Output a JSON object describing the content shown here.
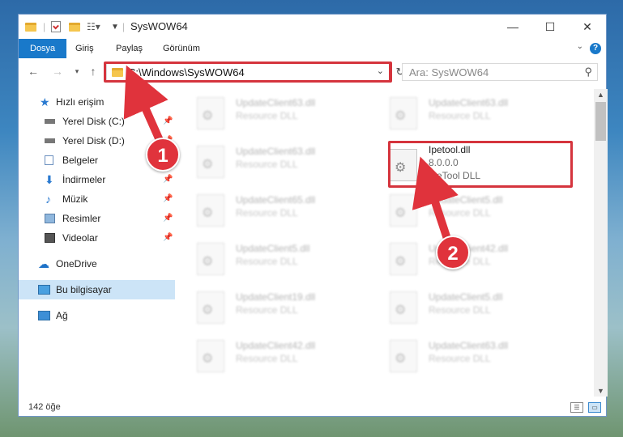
{
  "window": {
    "title": "SysWOW64",
    "controls": {
      "minimize": "—",
      "maximize": "☐",
      "close": "✕"
    }
  },
  "ribbon": {
    "tabs": [
      "Dosya",
      "Giriş",
      "Paylaş",
      "Görünüm"
    ],
    "help": "?"
  },
  "address_bar": {
    "path": "C:\\Windows\\SysWOW64"
  },
  "search": {
    "placeholder": "Ara: SysWOW64"
  },
  "sidebar": {
    "items": [
      {
        "label": "Hızlı erişim",
        "icon": "star-icon",
        "pinned": false
      },
      {
        "label": "Yerel Disk (C:)",
        "icon": "drive-icon",
        "pinned": true
      },
      {
        "label": "Yerel Disk (D:)",
        "icon": "drive-icon",
        "pinned": true
      },
      {
        "label": "Belgeler",
        "icon": "documents-icon",
        "pinned": true
      },
      {
        "label": "İndirmeler",
        "icon": "download-icon",
        "pinned": true
      },
      {
        "label": "Müzik",
        "icon": "music-icon",
        "pinned": true
      },
      {
        "label": "Resimler",
        "icon": "pictures-icon",
        "pinned": true
      },
      {
        "label": "Videolar",
        "icon": "video-icon",
        "pinned": true
      },
      {
        "label": "OneDrive",
        "icon": "cloud-icon",
        "pinned": false
      },
      {
        "label": "Bu bilgisayar",
        "icon": "computer-icon",
        "pinned": false,
        "selected": true
      },
      {
        "label": "Ağ",
        "icon": "network-icon",
        "pinned": false
      }
    ]
  },
  "files": {
    "left_column": [
      {
        "name": "UpdateClient63.dll",
        "type": "Resource DLL"
      },
      {
        "name": "UpdateClient63.dll",
        "type": "Resource DLL"
      },
      {
        "name": "UpdateClient65.dll",
        "type": "Resource DLL"
      },
      {
        "name": "UpdateClient5.dll",
        "type": "Resource DLL"
      },
      {
        "name": "UpdateClient19.dll",
        "type": "Resource DLL"
      },
      {
        "name": "UpdateClient42.dll",
        "type": "Resource DLL"
      }
    ],
    "right_column": [
      {
        "name": "UpdateClient63.dll",
        "type": "Resource DLL"
      },
      {
        "name": "UpdateClient5.dll",
        "type": "Resource DLL"
      },
      {
        "name": "UpdateClient42.dll",
        "type": "Resource DLL"
      },
      {
        "name": "UpdateClient5.dll",
        "type": "Resource DLL"
      },
      {
        "name": "UpdateClient63.dll",
        "type": "Resource DLL"
      }
    ],
    "highlighted": {
      "name": "Ipetool.dll",
      "version": "8.0.0.0",
      "description": "IpeTool DLL"
    }
  },
  "status_bar": {
    "item_count": "142 öğe"
  },
  "callouts": [
    "1",
    "2"
  ],
  "colors": {
    "accent": "#1979ca",
    "highlight_border": "#d5343d",
    "callout": "#e0333c",
    "selection": "#cce4f7"
  }
}
